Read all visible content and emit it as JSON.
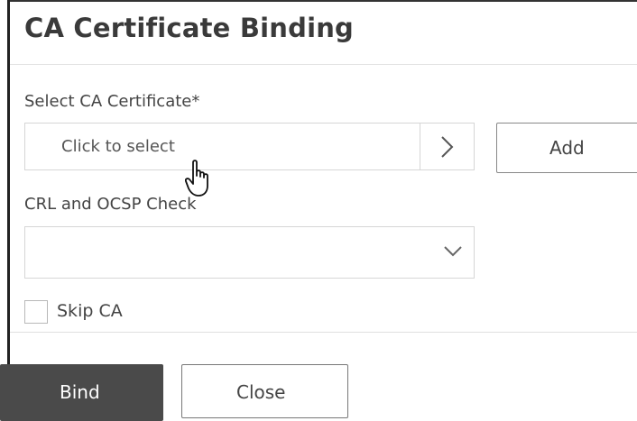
{
  "dialog": {
    "title": "CA Certificate Binding"
  },
  "ca_certificate": {
    "label": "Select CA Certificate*",
    "placeholder": "Click to select",
    "arrow_icon": "chevron-right-icon",
    "add_label": "Add"
  },
  "crl_check": {
    "label": "CRL and OCSP Check",
    "selected_value": "",
    "dropdown_icon": "chevron-down-icon"
  },
  "skip_ca": {
    "label": "Skip CA",
    "checked": false
  },
  "footer": {
    "bind_label": "Bind",
    "close_label": "Close"
  },
  "cursor": {
    "icon": "hand-pointer-icon"
  }
}
